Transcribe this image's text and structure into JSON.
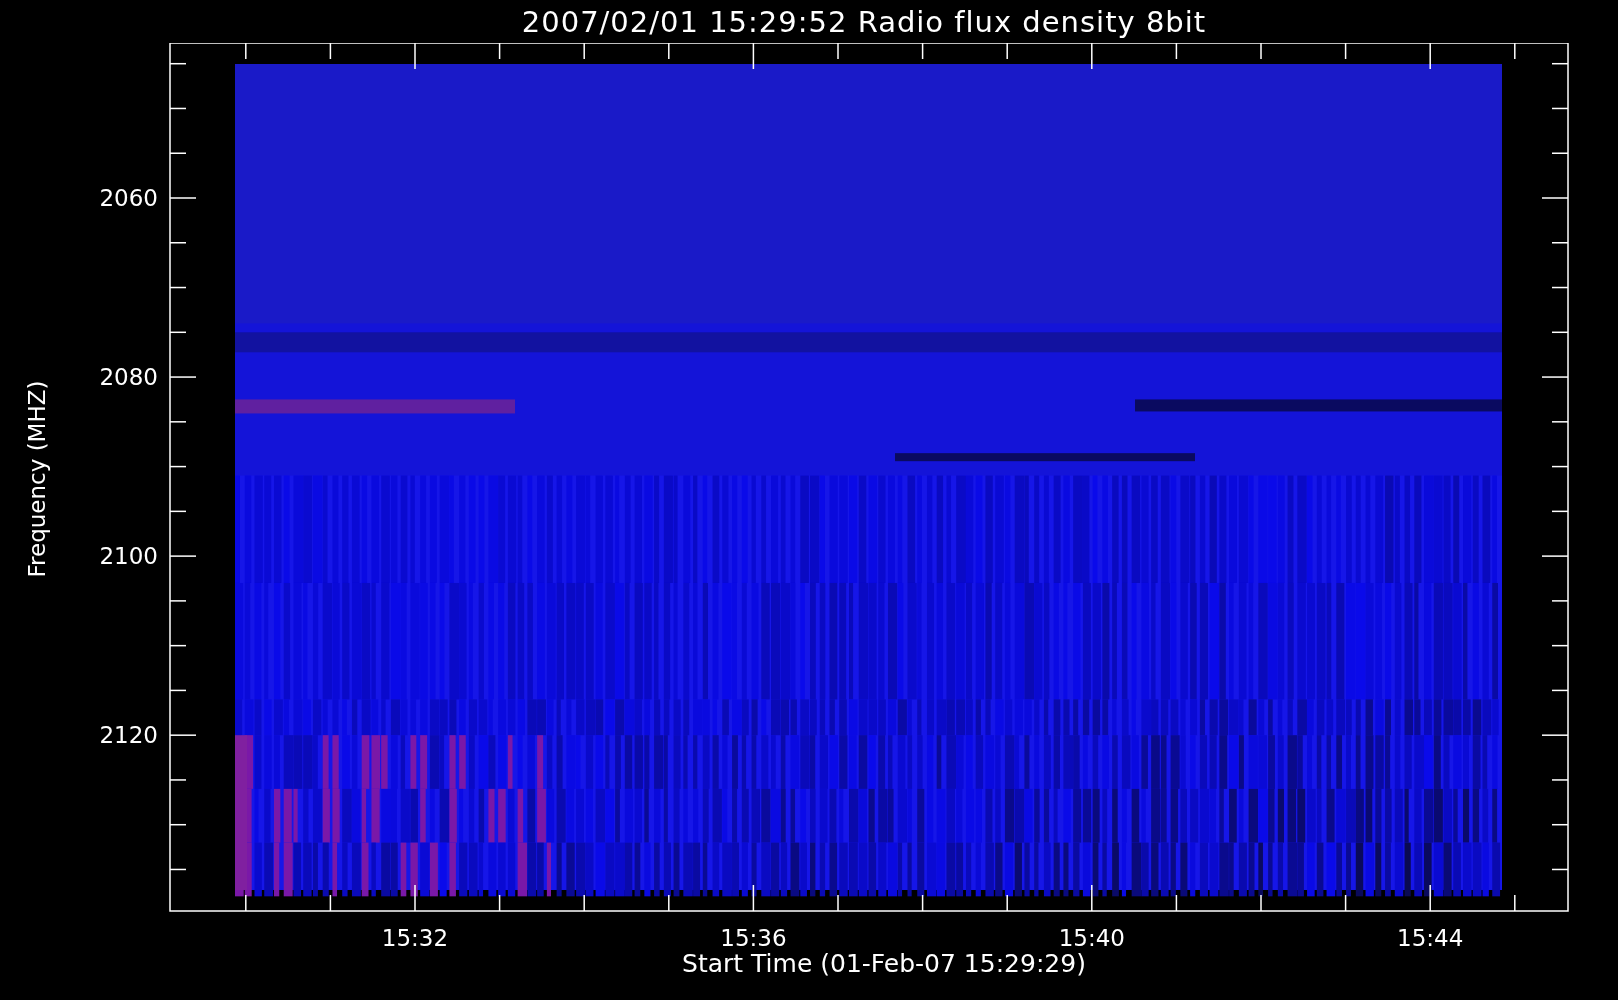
{
  "plot": {
    "title": "2007/02/01 15:29:52 Radio flux density 8bit",
    "xlabel": "Start Time (01-Feb-07 15:29:29)",
    "ylabel": "Frequency (MHZ)",
    "y_tick_labels": [
      "2060",
      "2080",
      "2100",
      "2120"
    ],
    "x_tick_labels": [
      "15:32",
      "15:36",
      "15:40",
      "15:44"
    ]
  }
}
